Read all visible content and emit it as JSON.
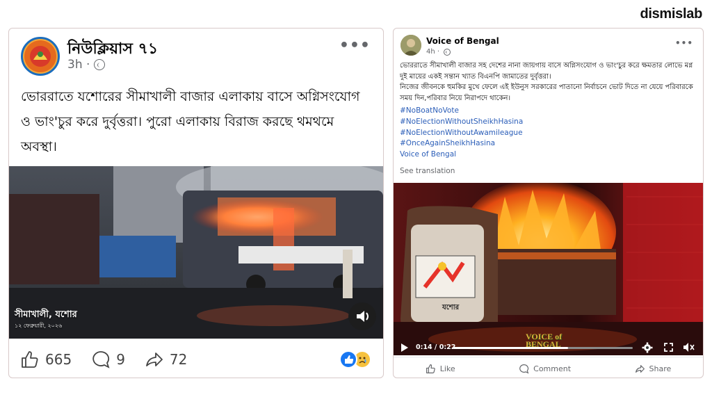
{
  "brand": "dismislab",
  "post_left": {
    "author": "নিউক্লিয়াস ৭১",
    "time": "3h ·",
    "text": "ভোররাতে যশোরের সীমাখালী বাজার এলাকায় বাসে অগ্নিসংযোগ ও ভাং'চুর করে দুর্বৃত্তরা। পুরো এলাকায় বিরাজ করছে থমথমে অবস্থা।",
    "video_caption": "সীমাখালী, যশোর",
    "video_date": "১২ ফেব্রুয়ারী, ২০২৬",
    "likes": "665",
    "comments": "9",
    "shares": "72",
    "reactions": [
      "like-icon",
      "sad-icon"
    ],
    "icons": [
      "more-icon",
      "globe-icon",
      "speaker-icon",
      "thumb-icon",
      "comment-icon",
      "share-icon"
    ]
  },
  "post_right": {
    "author": "Voice of Bengal",
    "time": "4h ·",
    "text": "ভোররাতে সীমাখালী বাজার সহ দেশের নানা জায়গায় বাসে অগ্নিসংযোগ ও ভাং'চুর করে ক্ষমতার লোভে মগ্ন দুই মায়ের একই সন্তান খ্যাত বিএনপি জামাতের দুর্বৃত্তরা।\nনিজের জীবনকে হুমকির মুখে ফেলে এই ইউনুস সরকারের পাতানো নির্বাচনে ভোট দিতে না যেয়ে পরিবারকে সময় দিন,পরিবার নিয়ে নিরাপদে থাকেন।",
    "hashtags": [
      "#NoBoatNoVote",
      "#NoElectionWithoutSheikhHasina",
      "#NoElectionWithoutAwamileague",
      "#OnceAgainSheikhHasina",
      "Voice of Bengal"
    ],
    "see_translation": "See translation",
    "video_time": "0:14 / 0:22",
    "video_progress": 0.64,
    "watermark": "VOICE of BENGAL",
    "bus_sign": "যশোর",
    "actions": [
      "Like",
      "Comment",
      "Share"
    ],
    "icons": [
      "more-icon",
      "globe-icon",
      "play-icon",
      "gear-icon",
      "fullscreen-icon",
      "volume-icon",
      "thumb-icon",
      "comment-icon",
      "share-icon"
    ]
  }
}
